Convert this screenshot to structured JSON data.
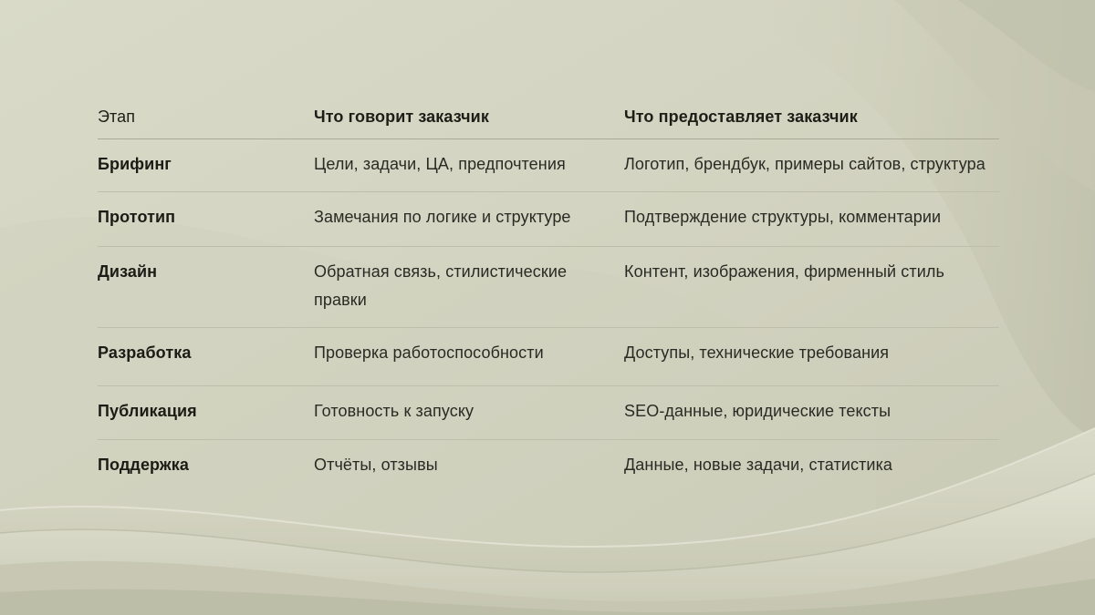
{
  "table": {
    "headers": [
      "Этап",
      "Что говорит заказчик",
      "Что предоставляет заказчик"
    ],
    "rows": [
      [
        "Брифинг",
        "Цели, задачи, ЦА, предпочтения",
        "Логотип, брендбук, примеры сайтов, структура"
      ],
      [
        "Прототип",
        "Замечания по логике и структуре",
        "Подтверждение структуры, комментарии"
      ],
      [
        "Дизайн",
        "Обратная связь, стилистические правки",
        "Контент, изображения, фирменный стиль"
      ],
      [
        "Разработка",
        "Проверка работоспособности",
        "Доступы, технические требования"
      ],
      [
        "Публикация",
        "Готовность к запуску",
        "SEO-данные, юридические тексты"
      ],
      [
        "Поддержка",
        "Отчёты, отзывы",
        "Данные, новые задачи, статистика"
      ]
    ]
  },
  "colors": {
    "background": "#d3d4c1",
    "text": "#1f1f1a",
    "divider": "#bdbeab"
  }
}
